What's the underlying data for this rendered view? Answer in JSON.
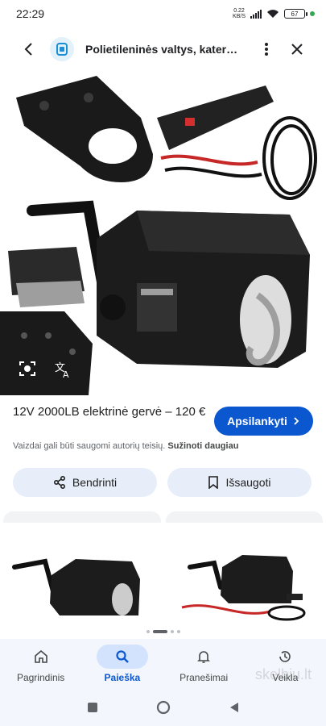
{
  "status": {
    "time": "22:29",
    "net_speed": "0.22",
    "net_unit": "KB/S",
    "battery": "67"
  },
  "topbar": {
    "site_title": "Polietileninės valtys, kateri..."
  },
  "result": {
    "title": "12V 2000LB elektrinė gervė – 120 €",
    "visit_label": "Apsilankyti",
    "copyright_text": "Vaizdai gali būti saugomi autorių teisių.",
    "learn_more": "Sužinoti daugiau"
  },
  "actions": {
    "share_label": "Bendrinti",
    "save_label": "Išsaugoti"
  },
  "nav": {
    "items": [
      {
        "label": "Pagrindinis"
      },
      {
        "label": "Paieška"
      },
      {
        "label": "Pranešimai"
      },
      {
        "label": "Veikla"
      }
    ]
  },
  "watermark": "skelbiu.lt",
  "colors": {
    "accent": "#0b57d0",
    "chip_bg": "#e8eef9",
    "nav_bg": "#f3f6fc"
  }
}
